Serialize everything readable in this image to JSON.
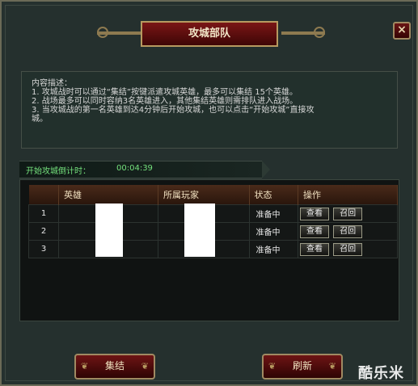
{
  "window": {
    "title": "攻城部队",
    "close_label": "×"
  },
  "description": {
    "heading": "内容描述：",
    "lines": [
      "1. 攻城战时可以通过“集结”按键派遣攻城英雄，最多可以集结 15个英雄。",
      "2. 战场最多可以同时容纳3名英雄进入，其他集结英雄则需排队进入战场。",
      "3. 当攻城战的第一名英雄到达4分钟后开始攻城，也可以点击“开始攻城”直接攻",
      "城。"
    ]
  },
  "countdown": {
    "label": "开始攻城倒计时：",
    "value": "00:04:39"
  },
  "table": {
    "headers": [
      "",
      "英雄",
      "所属玩家",
      "状态",
      "操作"
    ],
    "rows": [
      {
        "num": "1",
        "status": "准备中",
        "view": "查看",
        "recall": "召回"
      },
      {
        "num": "2",
        "status": "准备中",
        "view": "查看",
        "recall": "召回"
      },
      {
        "num": "3",
        "status": "准备中",
        "view": "查看",
        "recall": "召回"
      }
    ]
  },
  "buttons": {
    "gather": "集结",
    "refresh": "刷新"
  },
  "watermark": "酷乐米"
}
